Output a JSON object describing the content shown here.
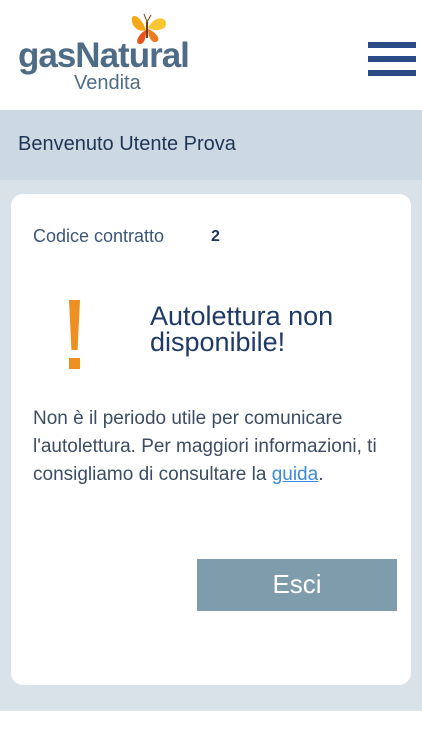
{
  "header": {
    "brand": "gasNatural",
    "brand_sub": "Vendita"
  },
  "welcome": {
    "text": "Benvenuto Utente Prova"
  },
  "contract": {
    "label": "Codice contratto",
    "value": "2"
  },
  "alert": {
    "title": "Autolettura non disponibile!",
    "message_before": "Non è il periodo utile per comunicare l'autolettura. Per maggiori informazioni, ti consigliamo di consultare la ",
    "link_text": "guida",
    "message_after": "."
  },
  "actions": {
    "exit_label": "Esci"
  },
  "colors": {
    "brand": "#4f6c86",
    "menu": "#2a4a86",
    "warning": "#ed8f21",
    "link": "#3a8ad8",
    "button": "#7f9cad"
  }
}
